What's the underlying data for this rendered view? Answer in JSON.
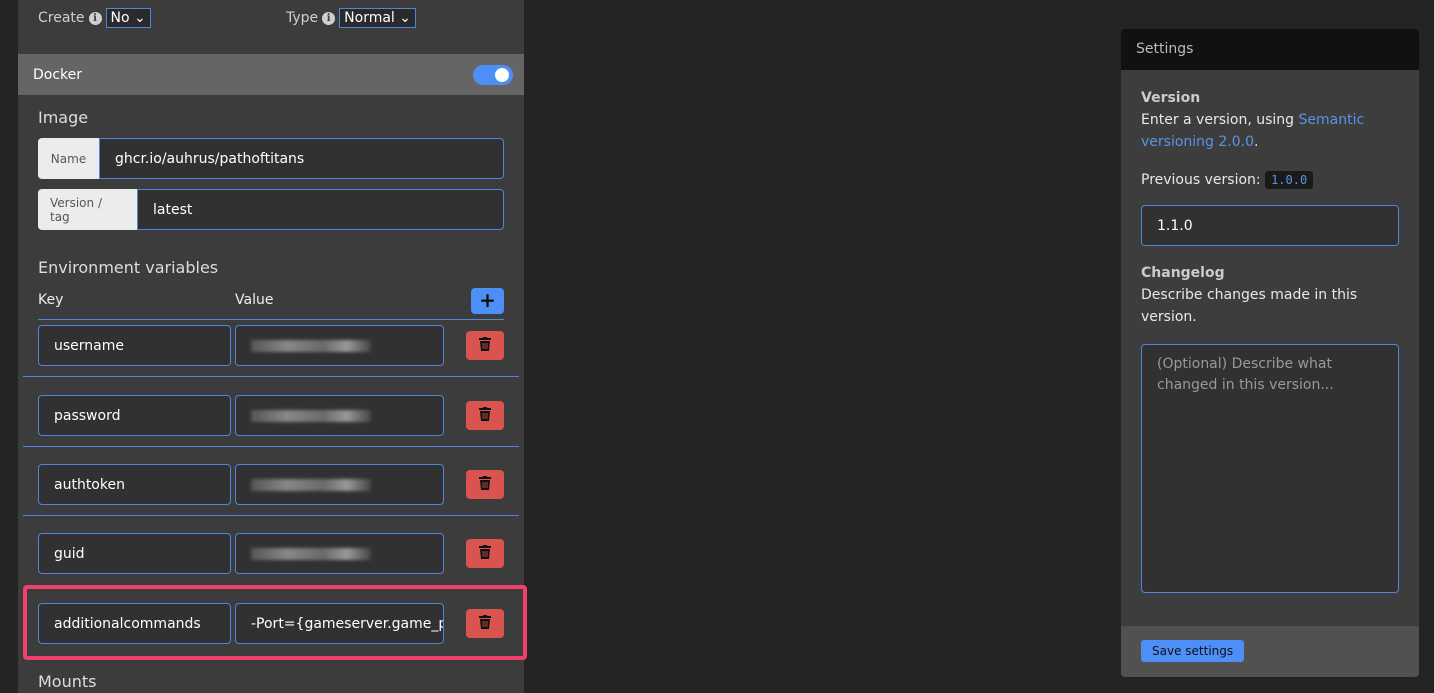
{
  "top": {
    "create_label": "Create",
    "create_value": "No",
    "type_label": "Type",
    "type_value": "Normal"
  },
  "docker": {
    "title": "Docker",
    "enabled": true
  },
  "image": {
    "heading": "Image",
    "name_label": "Name",
    "name_value": "ghcr.io/auhrus/pathoftitans",
    "tag_label": "Version / tag",
    "tag_value": "latest"
  },
  "env": {
    "heading": "Environment variables",
    "key_header": "Key",
    "value_header": "Value",
    "rows": [
      {
        "key": "username",
        "value": ""
      },
      {
        "key": "password",
        "value": ""
      },
      {
        "key": "authtoken",
        "value": ""
      },
      {
        "key": "guid",
        "value": ""
      },
      {
        "key": "additionalcommands",
        "value": "-Port={gameserver.game_p"
      }
    ]
  },
  "mounts": {
    "heading": "Mounts"
  },
  "settings": {
    "title": "Settings",
    "version_heading": "Version",
    "version_text": "Enter a version, using ",
    "version_link": "Semantic versioning 2.0.0",
    "version_period": ".",
    "previous_label": "Previous version:",
    "previous_value": "1.0.0",
    "version_input": "1.1.0",
    "changelog_heading": "Changelog",
    "changelog_text": "Describe changes made in this version.",
    "changelog_placeholder": "(Optional) Describe what changed in this version...",
    "save_label": "Save settings"
  },
  "colors": {
    "accent": "#4d8ef7",
    "danger": "#d9534f",
    "highlight": "#f0406e"
  }
}
